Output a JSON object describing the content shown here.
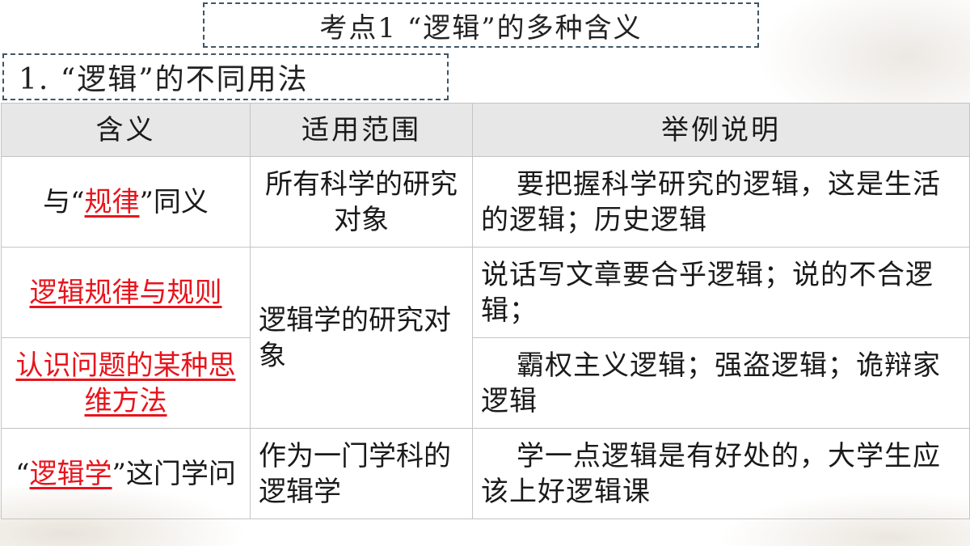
{
  "title": "考点1  “逻辑”的多种含义",
  "subtitle": "1. “逻辑”的不同用法",
  "table": {
    "headers": [
      "含义",
      "适用范围",
      "举例说明"
    ],
    "rows": [
      {
        "meaning_pre": "与“",
        "meaning_red": "规律",
        "meaning_post": "”同义",
        "scope": "所有科学的研究对象",
        "example": "要把握科学研究的逻辑，这是生活的逻辑；历史逻辑"
      },
      {
        "meaning_red": "逻辑规律与规则",
        "scope": "逻辑学的研究对象",
        "example": "说话写文章要合乎逻辑；说的不合逻辑；"
      },
      {
        "meaning_red": "认识问题的某种思维方法",
        "example": "霸权主义逻辑；强盗逻辑；诡辩家逻辑"
      },
      {
        "meaning_pre": "“",
        "meaning_red": "逻辑学",
        "meaning_post": "”这门学问",
        "scope": "作为一门学科的逻辑学",
        "example": "学一点逻辑是有好处的，大学生应该上好逻辑课"
      }
    ]
  }
}
